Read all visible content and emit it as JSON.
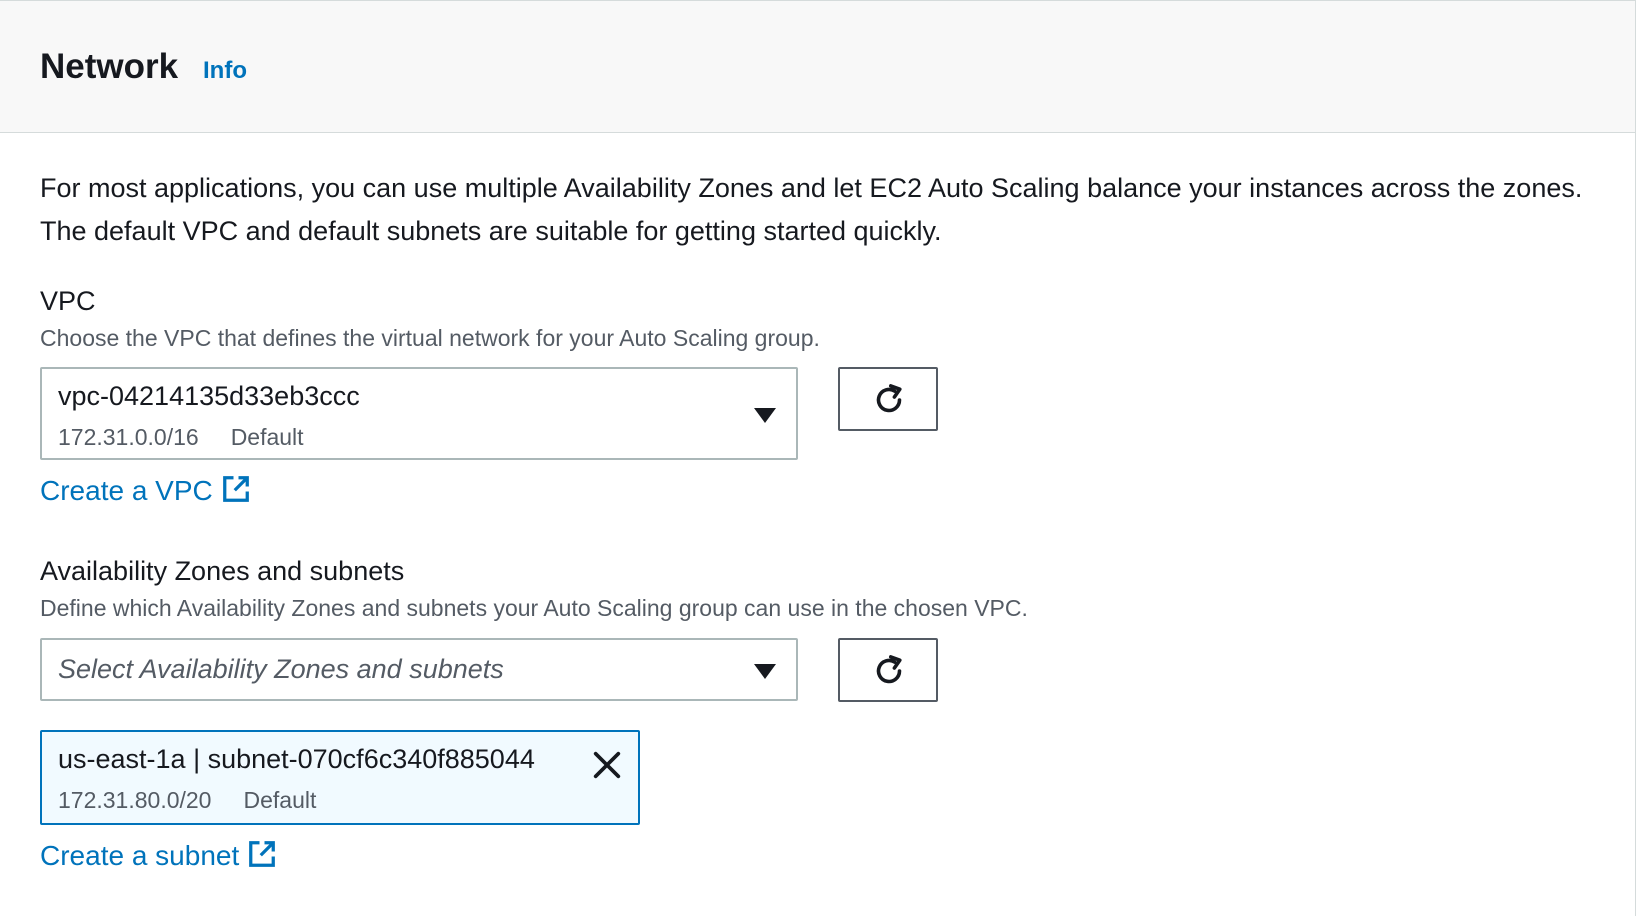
{
  "header": {
    "title": "Network",
    "info_label": "Info"
  },
  "description": "For most applications, you can use multiple Availability Zones and let EC2 Auto Scaling balance your instances across the zones. The default VPC and default subnets are suitable for getting started quickly.",
  "vpc": {
    "label": "VPC",
    "description": "Choose the VPC that defines the virtual network for your Auto Scaling group.",
    "selected_id": "vpc-04214135d33eb3ccc",
    "selected_cidr": "172.31.0.0/16",
    "selected_tag": "Default",
    "create_link": "Create a VPC"
  },
  "subnets": {
    "label": "Availability Zones and subnets",
    "description": "Define which Availability Zones and subnets your Auto Scaling group can use in the chosen VPC.",
    "placeholder": "Select Availability Zones and subnets",
    "tokens": [
      {
        "name": "us-east-1a | subnet-070cf6c340f885044",
        "cidr": "172.31.80.0/20",
        "tag": "Default"
      }
    ],
    "create_link": "Create a subnet"
  },
  "icons": {
    "dropdown": "caret-down-icon",
    "refresh": "refresh-icon",
    "external": "external-link-icon",
    "remove": "close-icon"
  },
  "colors": {
    "link": "#0073bb",
    "header_bg": "#f8f8f8",
    "token_bg": "#f1faff",
    "token_border": "#0073bb"
  }
}
